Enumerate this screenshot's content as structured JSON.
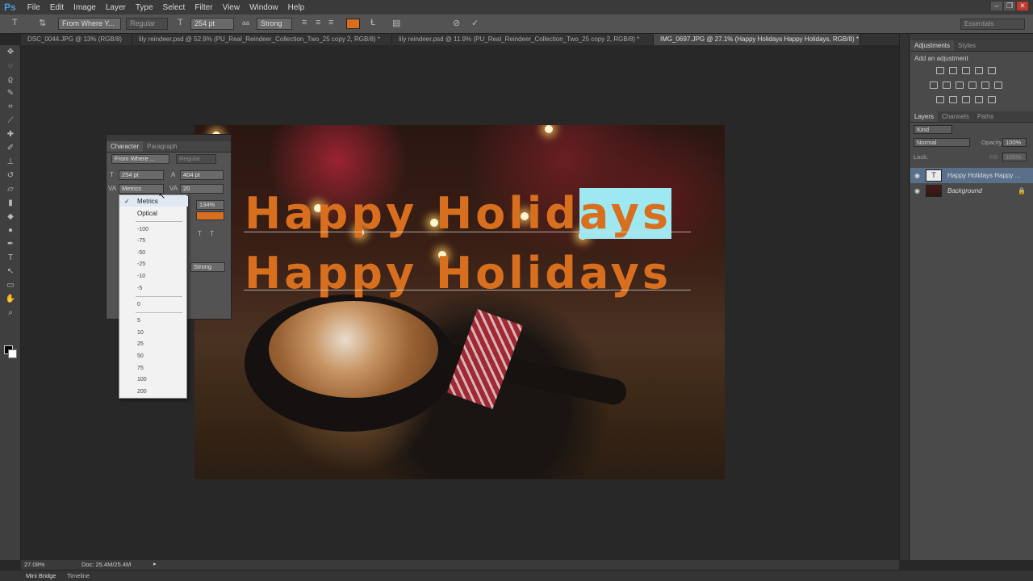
{
  "app": {
    "logo": "Ps"
  },
  "menu": [
    "File",
    "Edit",
    "Image",
    "Layer",
    "Type",
    "Select",
    "Filter",
    "View",
    "Window",
    "Help"
  ],
  "options_bar": {
    "font_family": "From Where Y...",
    "font_style": "Regular",
    "font_size": "254 pt",
    "antialias": "Strong",
    "text_color": "#d86f1e",
    "workspace": "Essentials"
  },
  "tabs": [
    "DSC_0044.JPG @ 13% (RGB/8)",
    "lily reindeer.psd @ 52.9% (PU_Real_Reindeer_Collection_Two_25 copy 2, RGB/8) *",
    "lily reindeer.psd @ 11.9% (PU_Real_Reindeer_Collection_Two_25 copy 2, RGB/8) *",
    "IMG_0697.JPG @ 27.1% (Happy Holidays Happy Holidays, RGB/8) *"
  ],
  "character_panel": {
    "tabs": [
      "Character",
      "Paragraph"
    ],
    "font_family": "From Where ...",
    "font_style": "Regular",
    "size": "254 pt",
    "leading": "404 pt",
    "kerning": "Metrics",
    "tracking": "20",
    "vertical_scale": "134%",
    "antialias": "Strong"
  },
  "kerning_dropdown": {
    "named": [
      "Metrics",
      "Optical"
    ],
    "selected": "Metrics",
    "negatives": [
      "-100",
      "-75",
      "-50",
      "-25",
      "-10",
      "-5"
    ],
    "zero": "0",
    "positives": [
      "5",
      "10",
      "25",
      "50",
      "75",
      "100",
      "200"
    ]
  },
  "canvas": {
    "line1_pre": "Happy Holid",
    "line1_hl": "ays",
    "line2": "Happy Holidays",
    "text_color": "#d86f1e",
    "highlight_color": "#9ee8f1"
  },
  "adjustments": {
    "tabs": [
      "Adjustments",
      "Styles"
    ],
    "subtitle": "Add an adjustment"
  },
  "layers_panel": {
    "tabs": [
      "Layers",
      "Channels",
      "Paths"
    ],
    "kind": "Kind",
    "blend_mode": "Normal",
    "opacity_label": "Opacity:",
    "opacity": "100%",
    "lock_label": "Lock:",
    "fill_label": "Fill:",
    "fill": "100%",
    "layers": [
      {
        "name": "Happy Holidays Happy ...",
        "thumb": "T",
        "selected": true
      },
      {
        "name": "Background",
        "thumb": "",
        "selected": false
      }
    ]
  },
  "status": {
    "zoom": "27.08%",
    "doc": "Doc: 25.4M/25.4M"
  },
  "bottom": {
    "tabs": [
      "Mini Bridge",
      "Timeline"
    ]
  }
}
